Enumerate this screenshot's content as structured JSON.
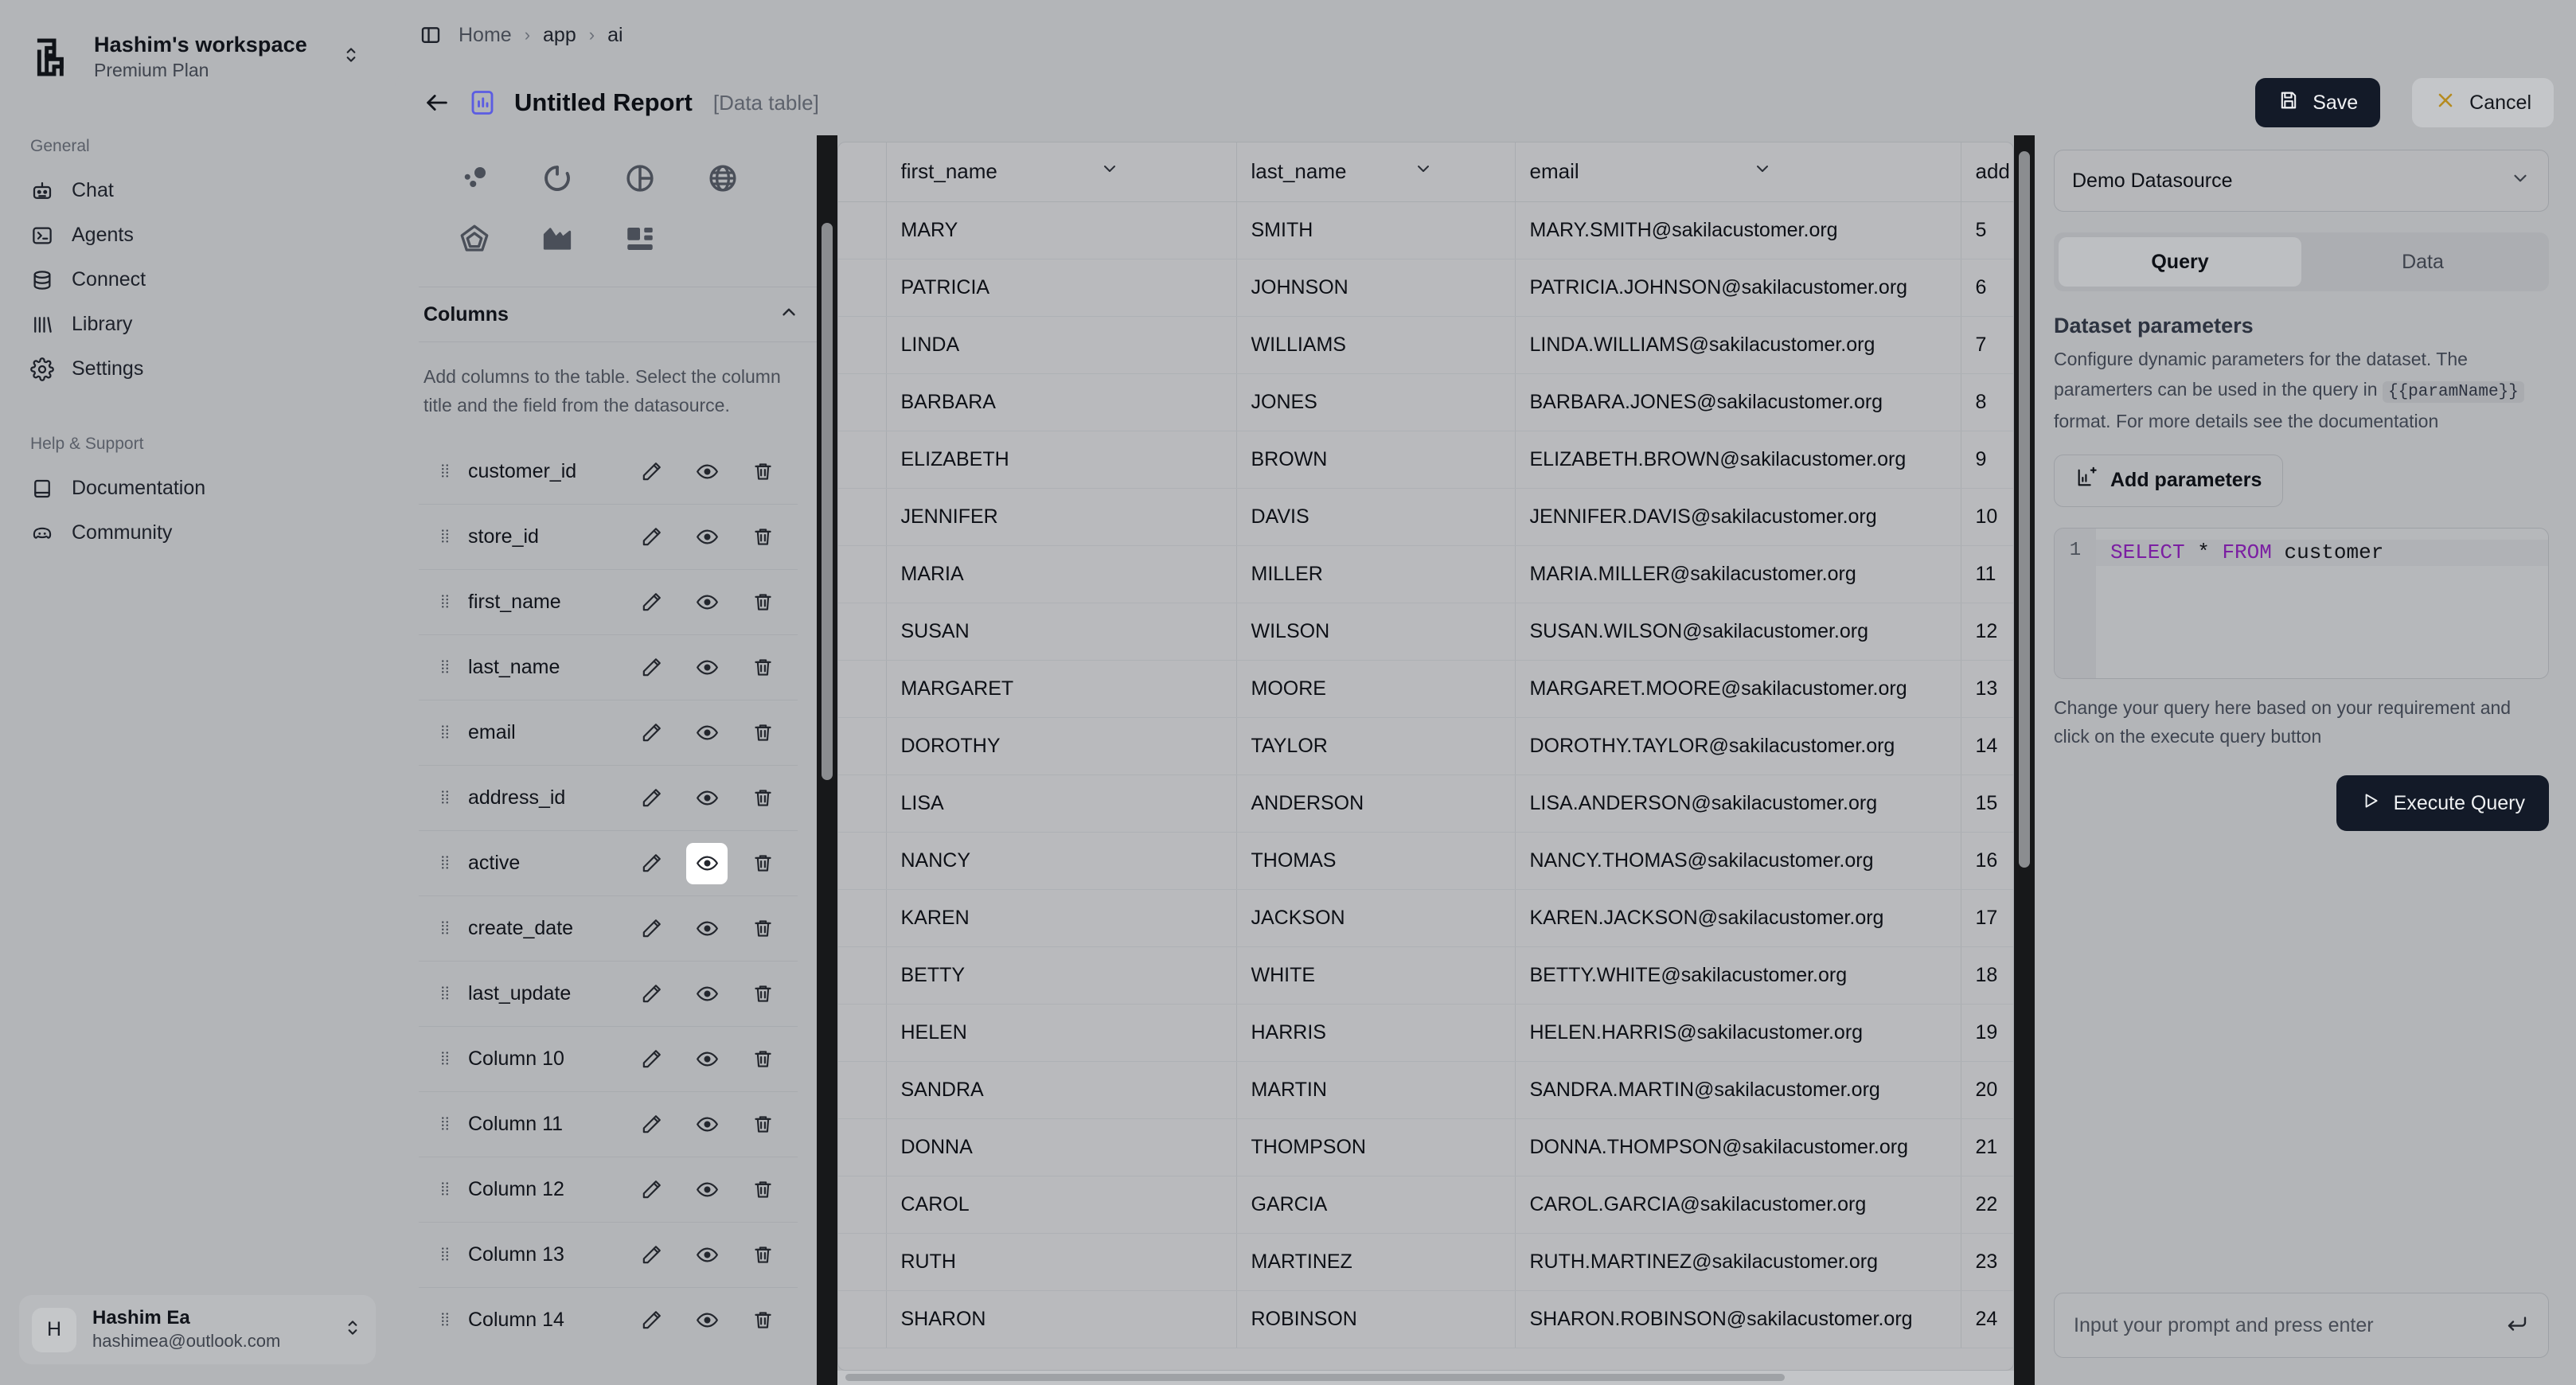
{
  "sidebar": {
    "workspace": {
      "name": "Hashim's workspace",
      "plan": "Premium Plan",
      "logo_icon": "workspace-logo-icon",
      "switch_icon": "chevron-up-down-icon"
    },
    "sections": [
      {
        "title": "General",
        "items": [
          {
            "label": "Chat",
            "icon": "robot-icon"
          },
          {
            "label": "Agents",
            "icon": "terminal-icon"
          },
          {
            "label": "Connect",
            "icon": "database-icon"
          },
          {
            "label": "Library",
            "icon": "bars-icon"
          },
          {
            "label": "Settings",
            "icon": "gear-icon"
          }
        ]
      },
      {
        "title": "Help & Support",
        "items": [
          {
            "label": "Documentation",
            "icon": "book-icon"
          },
          {
            "label": "Community",
            "icon": "discord-icon"
          }
        ]
      }
    ],
    "user": {
      "initial": "H",
      "name": "Hashim Ea",
      "email": "hashimea@outlook.com",
      "switch_icon": "chevron-up-down-icon"
    }
  },
  "topbar": {
    "panel_toggle_icon": "panel-left-icon",
    "breadcrumbs": [
      "Home",
      "app",
      "ai"
    ],
    "separator": "›"
  },
  "report": {
    "back_icon": "arrow-left-icon",
    "type_icon": "bar-chart-icon",
    "title": "Untitled Report",
    "subtitle": "[Data table]",
    "save_label": "Save",
    "save_icon": "save-icon",
    "cancel_label": "Cancel",
    "cancel_icon": "close-icon"
  },
  "config": {
    "chart_types": [
      "scatter-chart-icon",
      "donut-chart-icon",
      "pie-chart-icon",
      "radar-chart-icon",
      "polygon-chart-icon",
      "area-chart-icon",
      "data-table-icon"
    ],
    "columns_section": {
      "title": "Columns",
      "collapse_icon": "chevron-up-icon",
      "hint": "Add columns to the table. Select the column title and the field from the datasource.",
      "row_icons": {
        "drag": "drag-handle-icon",
        "edit": "pencil-icon",
        "visibility": "eye-icon",
        "delete": "trash-icon"
      },
      "rows": [
        {
          "name": "customer_id",
          "highlight": false
        },
        {
          "name": "store_id",
          "highlight": false
        },
        {
          "name": "first_name",
          "highlight": false
        },
        {
          "name": "last_name",
          "highlight": false
        },
        {
          "name": "email",
          "highlight": false
        },
        {
          "name": "address_id",
          "highlight": false
        },
        {
          "name": "active",
          "highlight": true
        },
        {
          "name": "create_date",
          "highlight": false
        },
        {
          "name": "last_update",
          "highlight": false
        },
        {
          "name": "Column 10",
          "highlight": false
        },
        {
          "name": "Column 11",
          "highlight": false
        },
        {
          "name": "Column 12",
          "highlight": false
        },
        {
          "name": "Column 13",
          "highlight": false
        },
        {
          "name": "Column 14",
          "highlight": false
        }
      ]
    }
  },
  "table": {
    "sort_icon": "chevron-down-icon",
    "columns": [
      "",
      "first_name",
      "last_name",
      "email",
      "add"
    ],
    "rows": [
      [
        "",
        "MARY",
        "SMITH",
        "MARY.SMITH@sakilacustomer.org",
        "5"
      ],
      [
        "",
        "PATRICIA",
        "JOHNSON",
        "PATRICIA.JOHNSON@sakilacustomer.org",
        "6"
      ],
      [
        "",
        "LINDA",
        "WILLIAMS",
        "LINDA.WILLIAMS@sakilacustomer.org",
        "7"
      ],
      [
        "",
        "BARBARA",
        "JONES",
        "BARBARA.JONES@sakilacustomer.org",
        "8"
      ],
      [
        "",
        "ELIZABETH",
        "BROWN",
        "ELIZABETH.BROWN@sakilacustomer.org",
        "9"
      ],
      [
        "",
        "JENNIFER",
        "DAVIS",
        "JENNIFER.DAVIS@sakilacustomer.org",
        "10"
      ],
      [
        "",
        "MARIA",
        "MILLER",
        "MARIA.MILLER@sakilacustomer.org",
        "11"
      ],
      [
        "",
        "SUSAN",
        "WILSON",
        "SUSAN.WILSON@sakilacustomer.org",
        "12"
      ],
      [
        "",
        "MARGARET",
        "MOORE",
        "MARGARET.MOORE@sakilacustomer.org",
        "13"
      ],
      [
        "",
        "DOROTHY",
        "TAYLOR",
        "DOROTHY.TAYLOR@sakilacustomer.org",
        "14"
      ],
      [
        "",
        "LISA",
        "ANDERSON",
        "LISA.ANDERSON@sakilacustomer.org",
        "15"
      ],
      [
        "",
        "NANCY",
        "THOMAS",
        "NANCY.THOMAS@sakilacustomer.org",
        "16"
      ],
      [
        "",
        "KAREN",
        "JACKSON",
        "KAREN.JACKSON@sakilacustomer.org",
        "17"
      ],
      [
        "",
        "BETTY",
        "WHITE",
        "BETTY.WHITE@sakilacustomer.org",
        "18"
      ],
      [
        "",
        "HELEN",
        "HARRIS",
        "HELEN.HARRIS@sakilacustomer.org",
        "19"
      ],
      [
        "",
        "SANDRA",
        "MARTIN",
        "SANDRA.MARTIN@sakilacustomer.org",
        "20"
      ],
      [
        "",
        "DONNA",
        "THOMPSON",
        "DONNA.THOMPSON@sakilacustomer.org",
        "21"
      ],
      [
        "",
        "CAROL",
        "GARCIA",
        "CAROL.GARCIA@sakilacustomer.org",
        "22"
      ],
      [
        "",
        "RUTH",
        "MARTINEZ",
        "RUTH.MARTINEZ@sakilacustomer.org",
        "23"
      ],
      [
        "",
        "SHARON",
        "ROBINSON",
        "SHARON.ROBINSON@sakilacustomer.org",
        "24"
      ]
    ]
  },
  "query_panel": {
    "datasource": {
      "value": "Demo Datasource",
      "chevron_icon": "chevron-down-icon"
    },
    "tabs": [
      {
        "label": "Query",
        "active": true
      },
      {
        "label": "Data",
        "active": false
      }
    ],
    "dataset_parameters": {
      "title": "Dataset parameters",
      "desc_part1": "Configure dynamic parameters for the dataset. The paramerters can be used in the query in",
      "param_token": "{{paramName}}",
      "desc_part2": "format. For more details see the documentation",
      "add_label": "Add parameters",
      "add_icon": "add-chart-icon"
    },
    "editor": {
      "line_number": "1",
      "kw1": "SELECT",
      "star": "*",
      "kw2": "FROM",
      "table": "customer"
    },
    "editor_hint": "Change your query here based on your requirement and click on the execute query button",
    "execute": {
      "label": "Execute Query",
      "icon": "play-icon"
    },
    "prompt": {
      "placeholder": "Input your prompt and press enter",
      "submit_icon": "enter-arrow-icon"
    }
  },
  "colors": {
    "accent": "#5b5ce2",
    "dark_button": "#131a28",
    "cancel_x": "#b58b20",
    "sql_keyword": "#7b1fa2"
  }
}
